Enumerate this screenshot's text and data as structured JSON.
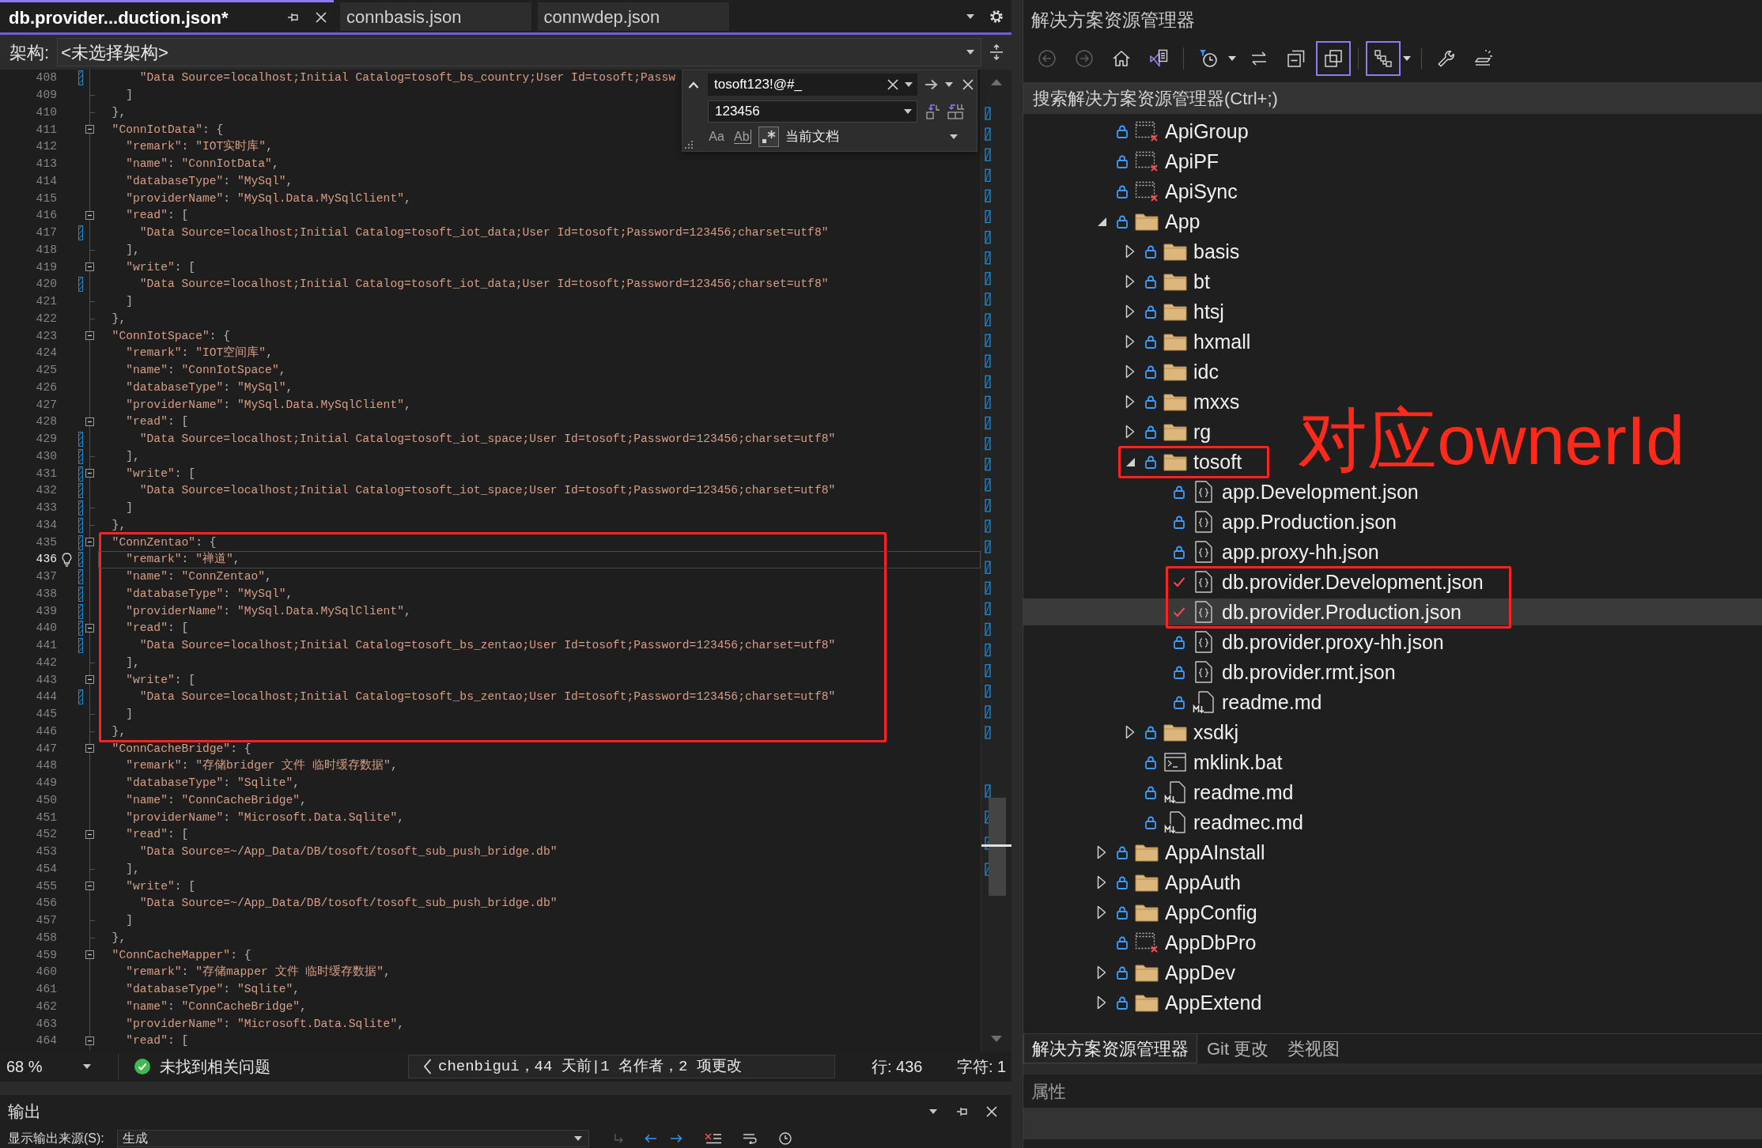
{
  "editor": {
    "tabs": [
      {
        "label": "db.provider...duction.json*",
        "selected": true
      },
      {
        "label": "connbasis.json",
        "selected": false
      },
      {
        "label": "connwdep.json",
        "selected": false
      }
    ],
    "navigation": {
      "label": "架构:",
      "value": "<未选择架构>"
    },
    "find": {
      "search": "tosoft123!@#_",
      "replace": "123456",
      "options": [
        {
          "kind": "match-case",
          "label": "Aa",
          "on": false
        },
        {
          "kind": "whole-word",
          "label": "Ab",
          "on": false
        },
        {
          "kind": "regex",
          "on": true
        }
      ],
      "scope": "当前文档"
    },
    "lines": [
      {
        "number": "408",
        "kind": "plain",
        "text": "      \"Data Source=localhost;Initial Catalog=tosoft_bs_country;User Id=tosoft;Passw",
        "changed": true,
        "selected": false,
        "boxed": false
      },
      {
        "number": "409",
        "kind": "closing",
        "text": "    ]",
        "changed": false,
        "selected": false,
        "boxed": false
      },
      {
        "number": "410",
        "kind": "closing",
        "text": "  },",
        "changed": false,
        "selected": false,
        "boxed": false
      },
      {
        "number": "411",
        "kind": "opening",
        "text": "  \"ConnIotData\": {",
        "changed": false,
        "selected": false,
        "boxed": false
      },
      {
        "number": "412",
        "kind": "plain",
        "text": "    \"remark\": \"IOT实时库\",",
        "changed": false,
        "selected": false,
        "boxed": false
      },
      {
        "number": "413",
        "kind": "plain",
        "text": "    \"name\": \"ConnIotData\",",
        "changed": false,
        "selected": false,
        "boxed": false
      },
      {
        "number": "414",
        "kind": "plain",
        "text": "    \"databaseType\": \"MySql\",",
        "changed": false,
        "selected": false,
        "boxed": false
      },
      {
        "number": "415",
        "kind": "plain",
        "text": "    \"providerName\": \"MySql.Data.MySqlClient\",",
        "changed": false,
        "selected": false,
        "boxed": false
      },
      {
        "number": "416",
        "kind": "opening",
        "text": "    \"read\": [",
        "changed": false,
        "selected": false,
        "boxed": false
      },
      {
        "number": "417",
        "kind": "plain",
        "text": "      \"Data Source=localhost;Initial Catalog=tosoft_iot_data;User Id=tosoft;Password=123456;charset=utf8\"",
        "changed": true,
        "selected": false,
        "boxed": false
      },
      {
        "number": "418",
        "kind": "closing",
        "text": "    ],",
        "changed": false,
        "selected": false,
        "boxed": false
      },
      {
        "number": "419",
        "kind": "opening",
        "text": "    \"write\": [",
        "changed": false,
        "selected": false,
        "boxed": false
      },
      {
        "number": "420",
        "kind": "plain",
        "text": "      \"Data Source=localhost;Initial Catalog=tosoft_iot_data;User Id=tosoft;Password=123456;charset=utf8\"",
        "changed": true,
        "selected": false,
        "boxed": false
      },
      {
        "number": "421",
        "kind": "closing",
        "text": "    ]",
        "changed": false,
        "selected": false,
        "boxed": false
      },
      {
        "number": "422",
        "kind": "closing",
        "text": "  },",
        "changed": false,
        "selected": false,
        "boxed": false
      },
      {
        "number": "423",
        "kind": "opening",
        "text": "  \"ConnIotSpace\": {",
        "changed": false,
        "selected": false,
        "boxed": false
      },
      {
        "number": "424",
        "kind": "plain",
        "text": "    \"remark\": \"IOT空间库\",",
        "changed": false,
        "selected": false,
        "boxed": false
      },
      {
        "number": "425",
        "kind": "plain",
        "text": "    \"name\": \"ConnIotSpace\",",
        "changed": false,
        "selected": false,
        "boxed": false
      },
      {
        "number": "426",
        "kind": "plain",
        "text": "    \"databaseType\": \"MySql\",",
        "changed": false,
        "selected": false,
        "boxed": false
      },
      {
        "number": "427",
        "kind": "plain",
        "text": "    \"providerName\": \"MySql.Data.MySqlClient\",",
        "changed": false,
        "selected": false,
        "boxed": false
      },
      {
        "number": "428",
        "kind": "opening",
        "text": "    \"read\": [",
        "changed": false,
        "selected": false,
        "boxed": false
      },
      {
        "number": "429",
        "kind": "plain",
        "text": "      \"Data Source=localhost;Initial Catalog=tosoft_iot_space;User Id=tosoft;Password=123456;charset=utf8\"",
        "changed": true,
        "selected": false,
        "boxed": false
      },
      {
        "number": "430",
        "kind": "closing",
        "text": "    ],",
        "changed": true,
        "selected": false,
        "boxed": false
      },
      {
        "number": "431",
        "kind": "opening",
        "text": "    \"write\": [",
        "changed": true,
        "selected": false,
        "boxed": false
      },
      {
        "number": "432",
        "kind": "plain",
        "text": "      \"Data Source=localhost;Initial Catalog=tosoft_iot_space;User Id=tosoft;Password=123456;charset=utf8\"",
        "changed": true,
        "selected": false,
        "boxed": false
      },
      {
        "number": "433",
        "kind": "closing",
        "text": "    ]",
        "changed": true,
        "selected": false,
        "boxed": false
      },
      {
        "number": "434",
        "kind": "closing",
        "text": "  },",
        "changed": true,
        "selected": false,
        "boxed": false
      },
      {
        "number": "435",
        "kind": "opening",
        "text": "  \"ConnZentao\": {",
        "changed": true,
        "selected": false,
        "boxed": true
      },
      {
        "number": "436",
        "kind": "plain",
        "text": "    \"remark\": \"禅道\",",
        "changed": true,
        "selected": true,
        "boxed": true
      },
      {
        "number": "437",
        "kind": "plain",
        "text": "    \"name\": \"ConnZentao\",",
        "changed": true,
        "selected": false,
        "boxed": true
      },
      {
        "number": "438",
        "kind": "plain",
        "text": "    \"databaseType\": \"MySql\",",
        "changed": true,
        "selected": false,
        "boxed": true
      },
      {
        "number": "439",
        "kind": "plain",
        "text": "    \"providerName\": \"MySql.Data.MySqlClient\",",
        "changed": true,
        "selected": false,
        "boxed": true
      },
      {
        "number": "440",
        "kind": "opening",
        "text": "    \"read\": [",
        "changed": true,
        "selected": false,
        "boxed": true
      },
      {
        "number": "441",
        "kind": "plain",
        "text": "      \"Data Source=localhost;Initial Catalog=tosoft_bs_zentao;User Id=tosoft;Password=123456;charset=utf8\"",
        "changed": true,
        "selected": false,
        "boxed": true
      },
      {
        "number": "442",
        "kind": "closing",
        "text": "    ],",
        "changed": false,
        "selected": false,
        "boxed": true
      },
      {
        "number": "443",
        "kind": "opening",
        "text": "    \"write\": [",
        "changed": false,
        "selected": false,
        "boxed": true
      },
      {
        "number": "444",
        "kind": "plain",
        "text": "      \"Data Source=localhost;Initial Catalog=tosoft_bs_zentao;User Id=tosoft;Password=123456;charset=utf8\"",
        "changed": true,
        "selected": false,
        "boxed": true
      },
      {
        "number": "445",
        "kind": "closing",
        "text": "    ]",
        "changed": false,
        "selected": false,
        "boxed": true
      },
      {
        "number": "446",
        "kind": "closing",
        "text": "  },",
        "changed": false,
        "selected": false,
        "boxed": true
      },
      {
        "number": "447",
        "kind": "opening",
        "text": "  \"ConnCacheBridge\": {",
        "changed": false,
        "selected": false,
        "boxed": false
      },
      {
        "number": "448",
        "kind": "plain",
        "text": "    \"remark\": \"存储bridger 文件 临时缓存数据\",",
        "changed": false,
        "selected": false,
        "boxed": false
      },
      {
        "number": "449",
        "kind": "plain",
        "text": "    \"databaseType\": \"Sqlite\",",
        "changed": false,
        "selected": false,
        "boxed": false
      },
      {
        "number": "450",
        "kind": "plain",
        "text": "    \"name\": \"ConnCacheBridge\",",
        "changed": false,
        "selected": false,
        "boxed": false
      },
      {
        "number": "451",
        "kind": "plain",
        "text": "    \"providerName\": \"Microsoft.Data.Sqlite\",",
        "changed": false,
        "selected": false,
        "boxed": false
      },
      {
        "number": "452",
        "kind": "opening",
        "text": "    \"read\": [",
        "changed": false,
        "selected": false,
        "boxed": false
      },
      {
        "number": "453",
        "kind": "plain",
        "text": "      \"Data Source=~/App_Data/DB/tosoft/tosoft_sub_push_bridge.db\"",
        "changed": false,
        "selected": false,
        "boxed": false
      },
      {
        "number": "454",
        "kind": "closing",
        "text": "    ],",
        "changed": false,
        "selected": false,
        "boxed": false
      },
      {
        "number": "455",
        "kind": "opening",
        "text": "    \"write\": [",
        "changed": false,
        "selected": false,
        "boxed": false
      },
      {
        "number": "456",
        "kind": "plain",
        "text": "      \"Data Source=~/App_Data/DB/tosoft/tosoft_sub_push_bridge.db\"",
        "changed": false,
        "selected": false,
        "boxed": false
      },
      {
        "number": "457",
        "kind": "closing",
        "text": "    ]",
        "changed": false,
        "selected": false,
        "boxed": false
      },
      {
        "number": "458",
        "kind": "closing",
        "text": "  },",
        "changed": false,
        "selected": false,
        "boxed": false
      },
      {
        "number": "459",
        "kind": "opening",
        "text": "  \"ConnCacheMapper\": {",
        "changed": false,
        "selected": false,
        "boxed": false
      },
      {
        "number": "460",
        "kind": "plain",
        "text": "    \"remark\": \"存储mapper 文件 临时缓存数据\",",
        "changed": false,
        "selected": false,
        "boxed": false
      },
      {
        "number": "461",
        "kind": "plain",
        "text": "    \"databaseType\": \"Sqlite\",",
        "changed": false,
        "selected": false,
        "boxed": false
      },
      {
        "number": "462",
        "kind": "plain",
        "text": "    \"name\": \"ConnCacheBridge\",",
        "changed": false,
        "selected": false,
        "boxed": false
      },
      {
        "number": "463",
        "kind": "plain",
        "text": "    \"providerName\": \"Microsoft.Data.Sqlite\",",
        "changed": false,
        "selected": false,
        "boxed": false
      },
      {
        "number": "464",
        "kind": "opening",
        "text": "    \"read\": [",
        "changed": false,
        "selected": false,
        "boxed": false
      }
    ],
    "status_bar": {
      "zoom": "68 %",
      "issues": "未找到相关问题",
      "blame": "chenbigui，44 天前|1 名作者，2 项更改",
      "line": "行: 436",
      "column": "字符: 1"
    }
  },
  "output": {
    "title": "输出",
    "source_label": "显示输出来源(S):",
    "source": "生成"
  },
  "solution_explorer": {
    "title": "解决方案资源管理器",
    "toolbar": [
      {
        "kind": "back",
        "disabled": true,
        "on": false,
        "menu": false
      },
      {
        "kind": "forward",
        "disabled": true,
        "on": false,
        "menu": false
      },
      {
        "kind": "home",
        "disabled": false,
        "on": false,
        "menu": false
      },
      {
        "kind": "switch-views",
        "disabled": false,
        "on": false,
        "menu": false
      },
      {
        "kind": "separator"
      },
      {
        "kind": "pending-changes",
        "disabled": false,
        "on": false,
        "menu": true
      },
      {
        "kind": "sync",
        "disabled": false,
        "on": false,
        "menu": false
      },
      {
        "kind": "collapse-all",
        "disabled": false,
        "on": false,
        "menu": false
      },
      {
        "kind": "show-all-files",
        "disabled": false,
        "on": true,
        "menu": false
      },
      {
        "kind": "separator"
      },
      {
        "kind": "view",
        "disabled": false,
        "on": true,
        "menu": true
      },
      {
        "kind": "separator"
      },
      {
        "kind": "properties",
        "disabled": false,
        "on": false,
        "menu": false
      },
      {
        "kind": "preview",
        "disabled": false,
        "on": false,
        "menu": false
      }
    ],
    "search": {
      "placeholder": "搜索解决方案资源管理器(Ctrl+;)"
    },
    "tree": [
      {
        "label": "ApiGroup",
        "kind": "unloaded-project",
        "checked_out": false,
        "selected": false,
        "boxed": false
      },
      {
        "label": "ApiPF",
        "kind": "unloaded-project",
        "checked_out": false,
        "selected": false,
        "boxed": false
      },
      {
        "label": "ApiSync",
        "kind": "unloaded-project",
        "checked_out": false,
        "selected": false,
        "boxed": false
      },
      {
        "label": "App",
        "kind": "folder",
        "checked_out": false,
        "expanded": true,
        "selected": false,
        "boxed": false,
        "children": [
          {
            "label": "basis",
            "kind": "folder",
            "checked_out": false,
            "expanded": false,
            "selected": false,
            "boxed": false
          },
          {
            "label": "bt",
            "kind": "folder",
            "checked_out": false,
            "expanded": false,
            "selected": false,
            "boxed": false
          },
          {
            "label": "htsj",
            "kind": "folder",
            "checked_out": false,
            "expanded": false,
            "selected": false,
            "boxed": false
          },
          {
            "label": "hxmall",
            "kind": "folder",
            "checked_out": false,
            "expanded": false,
            "selected": false,
            "boxed": false
          },
          {
            "label": "idc",
            "kind": "folder",
            "checked_out": false,
            "expanded": false,
            "selected": false,
            "boxed": false
          },
          {
            "label": "mxxs",
            "kind": "folder",
            "checked_out": false,
            "expanded": false,
            "selected": false,
            "boxed": false
          },
          {
            "label": "rg",
            "kind": "folder",
            "checked_out": false,
            "expanded": false,
            "selected": false,
            "boxed": false
          },
          {
            "label": "tosoft",
            "kind": "folder",
            "checked_out": false,
            "expanded": true,
            "selected": false,
            "boxed": true,
            "note": "对应ownerId",
            "children": [
              {
                "label": "app.Development.json",
                "kind": "json-file",
                "checked_out": false,
                "selected": false,
                "boxed": false
              },
              {
                "label": "app.Production.json",
                "kind": "json-file",
                "checked_out": false,
                "selected": false,
                "boxed": false
              },
              {
                "label": "app.proxy-hh.json",
                "kind": "json-file",
                "checked_out": false,
                "selected": false,
                "boxed": false
              },
              {
                "label": "db.provider.Development.json",
                "kind": "json-file",
                "checked_out": true,
                "selected": false,
                "boxed": true
              },
              {
                "label": "db.provider.Production.json",
                "kind": "json-file",
                "checked_out": true,
                "selected": true,
                "boxed": true
              },
              {
                "label": "db.provider.proxy-hh.json",
                "kind": "json-file",
                "checked_out": false,
                "selected": false,
                "boxed": false
              },
              {
                "label": "db.provider.rmt.json",
                "kind": "json-file",
                "checked_out": false,
                "selected": false,
                "boxed": false
              },
              {
                "label": "readme.md",
                "kind": "markdown-file",
                "checked_out": false,
                "selected": false,
                "boxed": false
              }
            ]
          },
          {
            "label": "xsdkj",
            "kind": "folder",
            "checked_out": false,
            "expanded": false,
            "selected": false,
            "boxed": false
          },
          {
            "label": "mklink.bat",
            "kind": "batch-file",
            "checked_out": false,
            "selected": false,
            "boxed": false
          },
          {
            "label": "readme.md",
            "kind": "markdown-file",
            "checked_out": false,
            "selected": false,
            "boxed": false
          },
          {
            "label": "readmec.md",
            "kind": "markdown-file",
            "checked_out": false,
            "selected": false,
            "boxed": false
          }
        ]
      },
      {
        "label": "AppAInstall",
        "kind": "folder",
        "checked_out": false,
        "expanded": false,
        "selected": false,
        "boxed": false
      },
      {
        "label": "AppAuth",
        "kind": "folder",
        "checked_out": false,
        "expanded": false,
        "selected": false,
        "boxed": false
      },
      {
        "label": "AppConfig",
        "kind": "folder",
        "checked_out": false,
        "expanded": false,
        "selected": false,
        "boxed": false
      },
      {
        "label": "AppDbPro",
        "kind": "unloaded-project",
        "checked_out": false,
        "selected": false,
        "boxed": false
      },
      {
        "label": "AppDev",
        "kind": "folder",
        "checked_out": false,
        "expanded": false,
        "selected": false,
        "boxed": false
      },
      {
        "label": "AppExtend",
        "kind": "folder",
        "checked_out": false,
        "expanded": false,
        "selected": false,
        "boxed": false
      }
    ],
    "tabs": [
      {
        "label": "解决方案资源管理器",
        "selected": true
      },
      {
        "label": "Git 更改",
        "selected": false
      },
      {
        "label": "类视图",
        "selected": false
      }
    ]
  },
  "properties": {
    "title": "属性"
  }
}
